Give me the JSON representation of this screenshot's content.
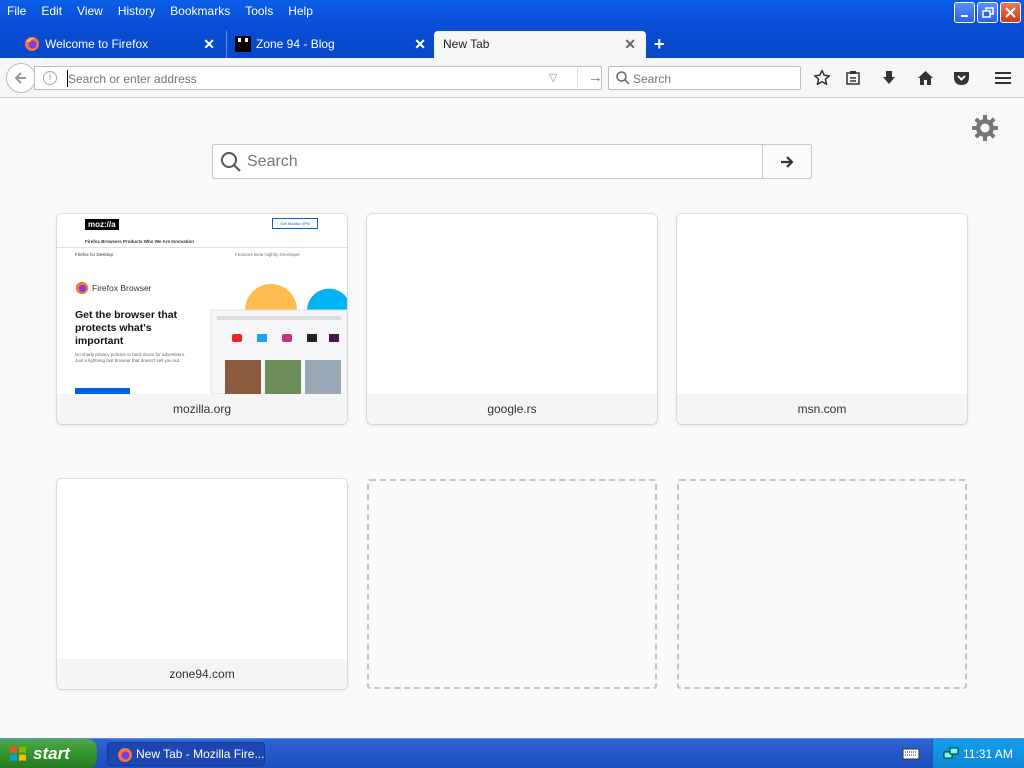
{
  "window": {
    "menu": [
      "File",
      "Edit",
      "View",
      "History",
      "Bookmarks",
      "Tools",
      "Help"
    ],
    "controls": {
      "minimize": "minimize",
      "restore": "restore",
      "close": "close"
    }
  },
  "tabs": [
    {
      "label": "Welcome to Firefox",
      "icon": "firefox-icon",
      "active": false
    },
    {
      "label": "Zone 94 - Blog",
      "icon": "zone94-icon",
      "active": false
    },
    {
      "label": "New Tab",
      "icon": "",
      "active": true
    }
  ],
  "navbar": {
    "url_placeholder": "Search or enter address",
    "url_value": "",
    "search_placeholder": "Search"
  },
  "newtab": {
    "search_placeholder": "Search",
    "tiles": [
      {
        "label": "mozilla.org",
        "has_thumbnail": true
      },
      {
        "label": "google.rs",
        "has_thumbnail": false
      },
      {
        "label": "msn.com",
        "has_thumbnail": false
      },
      {
        "label": "zone94.com",
        "has_thumbnail": false
      },
      {
        "label": "",
        "empty": true
      },
      {
        "label": "",
        "empty": true
      }
    ],
    "mozilla_thumb": {
      "logo": "moz://a",
      "download": "Get Mozilla VPN",
      "nav": "Firefox Browsers    Products    Who We Are    Innovation",
      "sub_left": "Firefox for Desktop",
      "sub_right": "Features   Beta   Nightly   Developer",
      "brand": "Firefox Browser",
      "headline": "Get the browser that protects what's important",
      "body": "No shady privacy policies or back doors for advertisers. Just a lightning fast browser that doesn't sell you out."
    }
  },
  "taskbar": {
    "start_label": "start",
    "task_label": "New Tab - Mozilla Fire...",
    "clock": "11:31 AM"
  },
  "colors": {
    "titlebar": "#0a4fd8",
    "tab_active": "#f5f6f7",
    "taskbar": "#2456c7",
    "start": "#2f8f2a",
    "tray": "#0f87d8"
  }
}
